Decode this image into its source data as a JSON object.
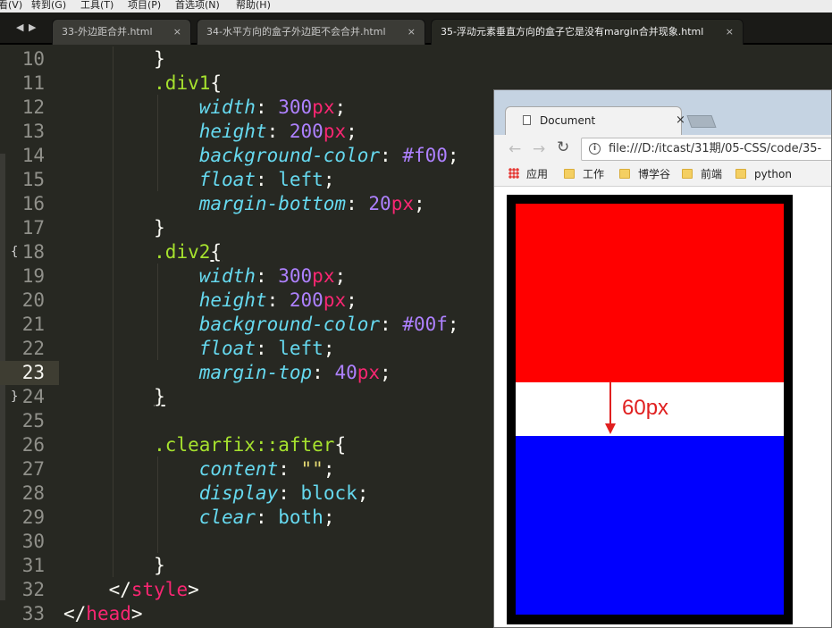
{
  "menu": [
    "看(V)",
    "转到(G)",
    "工具(T)",
    "项目(P)",
    "首选项(N)",
    "帮助(H)"
  ],
  "tabs": [
    {
      "label": "33-外边距合并.html",
      "close": "×"
    },
    {
      "label": "34-水平方向的盒子外边距不会合并.html",
      "close": "×"
    },
    {
      "label": "35-浮动元素垂直方向的盒子它是没有margin合并现象.html",
      "close": "×"
    }
  ],
  "nav": {
    "back": "◀",
    "forward": "▶"
  },
  "editor": {
    "current_line": "23",
    "fold_open_marker": "{",
    "fold_close_marker": "}",
    "lines": [
      {
        "n": "10",
        "indent": "        ",
        "parts": [
          {
            "t": "}",
            "c": ""
          }
        ]
      },
      {
        "n": "11",
        "indent": "        ",
        "parts": [
          {
            "t": ".div1",
            "c": "c-sel"
          },
          {
            "t": "{",
            "c": ""
          }
        ]
      },
      {
        "n": "12",
        "indent": "            ",
        "parts": [
          {
            "t": "width",
            "c": "c-prop"
          },
          {
            "t": ": ",
            "c": ""
          },
          {
            "t": "300",
            "c": "c-num"
          },
          {
            "t": "px",
            "c": "c-unit"
          },
          {
            "t": ";",
            "c": ""
          }
        ]
      },
      {
        "n": "13",
        "indent": "            ",
        "parts": [
          {
            "t": "height",
            "c": "c-prop"
          },
          {
            "t": ": ",
            "c": ""
          },
          {
            "t": "200",
            "c": "c-num"
          },
          {
            "t": "px",
            "c": "c-unit"
          },
          {
            "t": ";",
            "c": ""
          }
        ]
      },
      {
        "n": "14",
        "indent": "            ",
        "parts": [
          {
            "t": "background-color",
            "c": "c-prop"
          },
          {
            "t": ": ",
            "c": ""
          },
          {
            "t": "#f00",
            "c": "c-num"
          },
          {
            "t": ";",
            "c": ""
          }
        ]
      },
      {
        "n": "15",
        "indent": "            ",
        "parts": [
          {
            "t": "float",
            "c": "c-prop"
          },
          {
            "t": ": ",
            "c": ""
          },
          {
            "t": "left",
            "c": "c-kw"
          },
          {
            "t": ";",
            "c": ""
          }
        ]
      },
      {
        "n": "16",
        "indent": "            ",
        "parts": [
          {
            "t": "margin-bottom",
            "c": "c-prop"
          },
          {
            "t": ": ",
            "c": ""
          },
          {
            "t": "20",
            "c": "c-num"
          },
          {
            "t": "px",
            "c": "c-unit"
          },
          {
            "t": ";",
            "c": ""
          }
        ]
      },
      {
        "n": "17",
        "indent": "        ",
        "parts": [
          {
            "t": "}",
            "c": ""
          }
        ]
      },
      {
        "n": "18",
        "indent": "        ",
        "fold": "open",
        "parts": [
          {
            "t": ".div2",
            "c": "c-sel"
          },
          {
            "t": "{",
            "c": "c-u"
          }
        ]
      },
      {
        "n": "19",
        "indent": "            ",
        "parts": [
          {
            "t": "width",
            "c": "c-prop"
          },
          {
            "t": ": ",
            "c": ""
          },
          {
            "t": "300",
            "c": "c-num"
          },
          {
            "t": "px",
            "c": "c-unit"
          },
          {
            "t": ";",
            "c": ""
          }
        ]
      },
      {
        "n": "20",
        "indent": "            ",
        "parts": [
          {
            "t": "height",
            "c": "c-prop"
          },
          {
            "t": ": ",
            "c": ""
          },
          {
            "t": "200",
            "c": "c-num"
          },
          {
            "t": "px",
            "c": "c-unit"
          },
          {
            "t": ";",
            "c": ""
          }
        ]
      },
      {
        "n": "21",
        "indent": "            ",
        "parts": [
          {
            "t": "background-color",
            "c": "c-prop"
          },
          {
            "t": ": ",
            "c": ""
          },
          {
            "t": "#00f",
            "c": "c-num"
          },
          {
            "t": ";",
            "c": ""
          }
        ]
      },
      {
        "n": "22",
        "indent": "            ",
        "parts": [
          {
            "t": "float",
            "c": "c-prop"
          },
          {
            "t": ": ",
            "c": ""
          },
          {
            "t": "left",
            "c": "c-kw"
          },
          {
            "t": ";",
            "c": ""
          }
        ]
      },
      {
        "n": "23",
        "indent": "            ",
        "parts": [
          {
            "t": "margin-top",
            "c": "c-prop"
          },
          {
            "t": ": ",
            "c": ""
          },
          {
            "t": "40",
            "c": "c-num"
          },
          {
            "t": "px",
            "c": "c-unit"
          },
          {
            "t": ";",
            "c": ""
          }
        ]
      },
      {
        "n": "24",
        "indent": "        ",
        "fold": "close",
        "parts": [
          {
            "t": "}",
            "c": "c-u"
          }
        ]
      },
      {
        "n": "25",
        "indent": "",
        "parts": []
      },
      {
        "n": "26",
        "indent": "        ",
        "parts": [
          {
            "t": ".clearfix::after",
            "c": "c-sel"
          },
          {
            "t": "{",
            "c": ""
          }
        ]
      },
      {
        "n": "27",
        "indent": "            ",
        "parts": [
          {
            "t": "content",
            "c": "c-prop"
          },
          {
            "t": ": ",
            "c": ""
          },
          {
            "t": "\"\"",
            "c": "c-str"
          },
          {
            "t": ";",
            "c": ""
          }
        ]
      },
      {
        "n": "28",
        "indent": "            ",
        "parts": [
          {
            "t": "display",
            "c": "c-prop"
          },
          {
            "t": ": ",
            "c": ""
          },
          {
            "t": "block",
            "c": "c-kw"
          },
          {
            "t": ";",
            "c": ""
          }
        ]
      },
      {
        "n": "29",
        "indent": "            ",
        "parts": [
          {
            "t": "clear",
            "c": "c-prop"
          },
          {
            "t": ": ",
            "c": ""
          },
          {
            "t": "both",
            "c": "c-kw"
          },
          {
            "t": ";",
            "c": ""
          }
        ]
      },
      {
        "n": "30",
        "indent": "",
        "parts": []
      },
      {
        "n": "31",
        "indent": "        ",
        "parts": [
          {
            "t": "}",
            "c": ""
          }
        ]
      },
      {
        "n": "32",
        "indent": "    ",
        "parts": [
          {
            "t": "</",
            "c": ""
          },
          {
            "t": "style",
            "c": "c-tag"
          },
          {
            "t": ">",
            "c": ""
          }
        ]
      },
      {
        "n": "33",
        "indent": "",
        "parts": [
          {
            "t": "</",
            "c": ""
          },
          {
            "t": "head",
            "c": "c-tag"
          },
          {
            "t": ">",
            "c": ""
          }
        ]
      }
    ]
  },
  "browser": {
    "tab_title": "Document",
    "tab_close": "×",
    "back": "←",
    "forward": "→",
    "reload": "↻",
    "info": "i",
    "url": "file:///D:/itcast/31期/05-CSS/code/35-",
    "bookmarks": [
      {
        "label": "应用",
        "icon": "apps-icon"
      },
      {
        "label": "工作",
        "icon": "folder-icon"
      },
      {
        "label": "博学谷",
        "icon": "folder-icon"
      },
      {
        "label": "前端",
        "icon": "folder-icon"
      },
      {
        "label": "python",
        "icon": "folder-icon"
      }
    ],
    "demo": {
      "div1_color": "#ff0000",
      "div2_color": "#0000ff",
      "container_color": "#000000",
      "annotation": "60px",
      "annotation_color": "#e02020"
    }
  }
}
